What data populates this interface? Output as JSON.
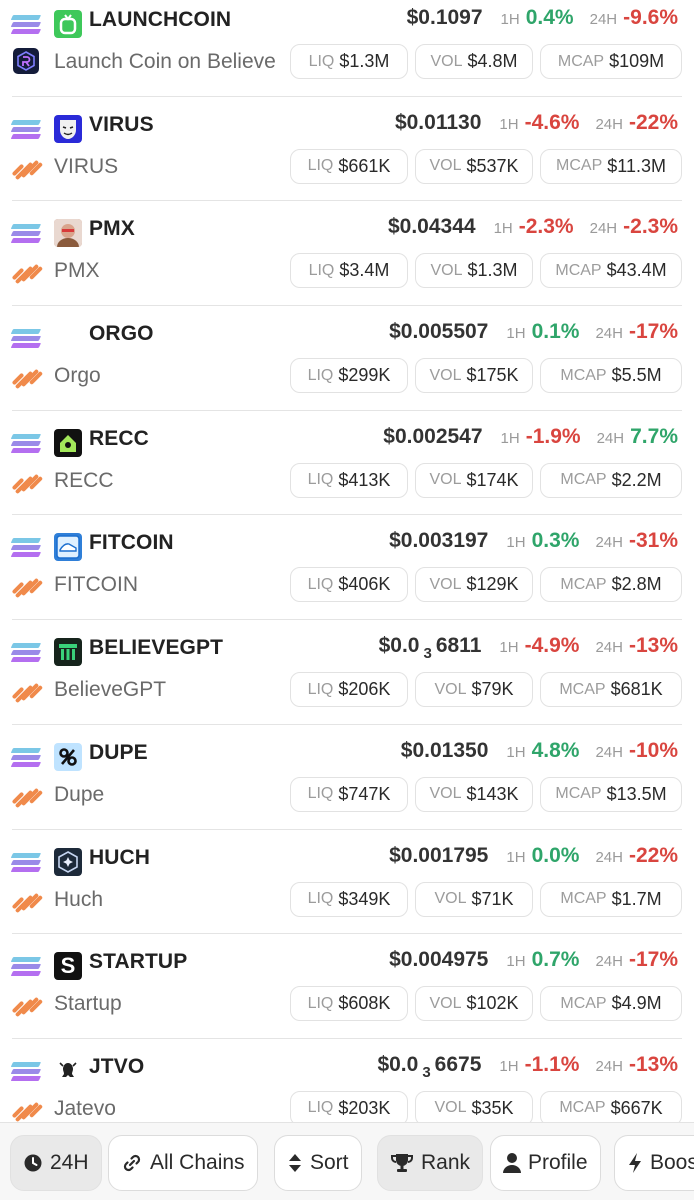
{
  "tokens": [
    {
      "symbol": "LAUNCHCOIN",
      "name": "Launch Coin on Believe",
      "price": "$0.1097",
      "price_sub": "",
      "price_tail": "",
      "h1": "0.4%",
      "h24": "-9.6%",
      "liq": "$1.3M",
      "vol": "$4.8M",
      "mcap": "$109M",
      "logo_icon": "launchcoin-icon",
      "logo_color": "#3ec85a",
      "dex_icon": "raydium-icon"
    },
    {
      "symbol": "VIRUS",
      "name": "VIRUS",
      "price": "$0.01130",
      "price_sub": "",
      "price_tail": "",
      "h1": "-4.6%",
      "h24": "-22%",
      "liq": "$661K",
      "vol": "$537K",
      "mcap": "$11.3M",
      "logo_icon": "mask-icon",
      "logo_color": "#2a2ad8",
      "dex_icon": "meteora-icon"
    },
    {
      "symbol": "PMX",
      "name": "PMX",
      "price": "$0.04344",
      "price_sub": "",
      "price_tail": "",
      "h1": "-2.3%",
      "h24": "-2.3%",
      "liq": "$3.4M",
      "vol": "$1.3M",
      "mcap": "$43.4M",
      "logo_icon": "avatar-icon",
      "logo_color": "#c98f7a",
      "dex_icon": "meteora-icon"
    },
    {
      "symbol": "ORGO",
      "name": "Orgo",
      "price": "$0.005507",
      "price_sub": "",
      "price_tail": "",
      "h1": "0.1%",
      "h24": "-17%",
      "liq": "$299K",
      "vol": "$175K",
      "mcap": "$5.5M",
      "logo_icon": "blank-icon",
      "logo_color": "#ffffff",
      "dex_icon": "meteora-icon"
    },
    {
      "symbol": "RECC",
      "name": "RECC",
      "price": "$0.002547",
      "price_sub": "",
      "price_tail": "",
      "h1": "-1.9%",
      "h24": "7.7%",
      "liq": "$413K",
      "vol": "$174K",
      "mcap": "$2.2M",
      "logo_icon": "house-icon",
      "logo_color": "#111111",
      "dex_icon": "meteora-icon"
    },
    {
      "symbol": "FITCOIN",
      "name": "FITCOIN",
      "price": "$0.003197",
      "price_sub": "",
      "price_tail": "",
      "h1": "0.3%",
      "h24": "-31%",
      "liq": "$406K",
      "vol": "$129K",
      "mcap": "$2.8M",
      "logo_icon": "shoe-icon",
      "logo_color": "#2f7fd8",
      "dex_icon": "meteora-icon"
    },
    {
      "symbol": "BELIEVEGPT",
      "name": "BelieveGPT",
      "price": "$0.0",
      "price_sub": "3",
      "price_tail": "6811",
      "h1": "-4.9%",
      "h24": "-13%",
      "liq": "$206K",
      "vol": "$79K",
      "mcap": "$681K",
      "logo_icon": "bars-icon",
      "logo_color": "#16241c",
      "dex_icon": "meteora-icon"
    },
    {
      "symbol": "DUPE",
      "name": "Dupe",
      "price": "$0.01350",
      "price_sub": "",
      "price_tail": "",
      "h1": "4.8%",
      "h24": "-10%",
      "liq": "$747K",
      "vol": "$143K",
      "mcap": "$13.5M",
      "logo_icon": "percent-icon",
      "logo_color": "#bfe3ff",
      "dex_icon": "meteora-icon"
    },
    {
      "symbol": "HUCH",
      "name": "Huch",
      "price": "$0.001795",
      "price_sub": "",
      "price_tail": "",
      "h1": "0.0%",
      "h24": "-22%",
      "liq": "$349K",
      "vol": "$71K",
      "mcap": "$1.7M",
      "logo_icon": "star-shield-icon",
      "logo_color": "#1d2a3a",
      "dex_icon": "meteora-icon"
    },
    {
      "symbol": "STARTUP",
      "name": "Startup",
      "price": "$0.004975",
      "price_sub": "",
      "price_tail": "",
      "h1": "0.7%",
      "h24": "-17%",
      "liq": "$608K",
      "vol": "$102K",
      "mcap": "$4.9M",
      "logo_icon": "letter-s-icon",
      "logo_color": "#111111",
      "dex_icon": "meteora-icon"
    },
    {
      "symbol": "JTVO",
      "name": "Jatevo",
      "price": "$0.0",
      "price_sub": "3",
      "price_tail": "6675",
      "h1": "-1.1%",
      "h24": "-13%",
      "liq": "$203K",
      "vol": "$35K",
      "mcap": "$667K",
      "logo_icon": "creature-icon",
      "logo_color": "#ffffff",
      "dex_icon": "meteora-icon"
    }
  ],
  "labels": {
    "h1": "1H",
    "h24": "24H",
    "liq": "LIQ",
    "vol": "VOL",
    "mcap": "MCAP"
  },
  "bottombar": {
    "timeframe": "24H",
    "chains": "All Chains",
    "sort": "Sort",
    "rank": "Rank",
    "profile": "Profile",
    "boost": "Boost"
  },
  "colors": {
    "positive": "#2fa56a",
    "negative": "#d9453f",
    "chain_solana": "#9a8ae8",
    "dex_meteora": "#f08a4b"
  }
}
